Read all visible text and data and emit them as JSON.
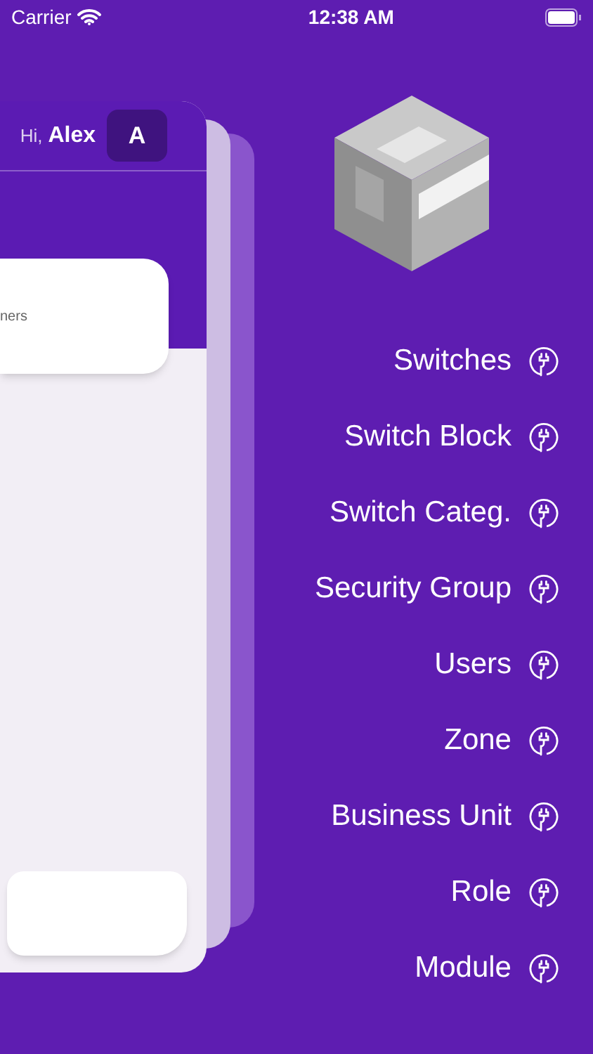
{
  "status_bar": {
    "carrier": "Carrier",
    "time": "12:38 AM"
  },
  "card": {
    "greeting": "Hi,",
    "user_name": "Alex",
    "avatar_initial": "A",
    "summary_text": "ners"
  },
  "menu": {
    "items": [
      {
        "label": "Switches"
      },
      {
        "label": "Switch Block"
      },
      {
        "label": "Switch Categ."
      },
      {
        "label": "Security Group"
      },
      {
        "label": "Users"
      },
      {
        "label": "Zone"
      },
      {
        "label": "Business Unit"
      },
      {
        "label": "Role"
      },
      {
        "label": "Module"
      }
    ]
  }
}
